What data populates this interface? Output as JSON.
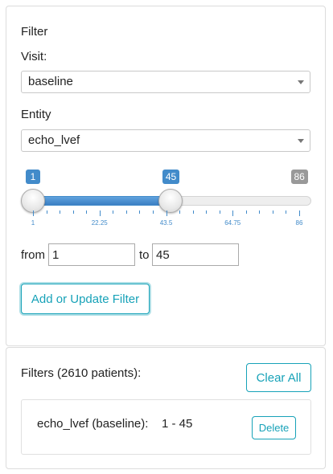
{
  "filter_panel": {
    "title": "Filter",
    "visit_label": "Visit:",
    "visit_value": "baseline",
    "entity_label": "Entity",
    "entity_value": "echo_lvef",
    "slider": {
      "min": 1,
      "max": 86,
      "from": 1,
      "to": 45,
      "min_label": "1",
      "max_label": "86",
      "from_label": "1",
      "to_label": "45",
      "tick_labels": [
        "1",
        "22.25",
        "43.5",
        "64.75",
        "86"
      ],
      "accent_color": "#428bca"
    },
    "from_label": "from",
    "to_label": "to",
    "from_value": "1",
    "to_value": "45",
    "add_button": "Add or Update Filter"
  },
  "filters_panel": {
    "title": "Filters (2610 patients):",
    "clear_button": "Clear All",
    "items": [
      {
        "name": "echo_lvef (baseline):",
        "range": "1 - 45",
        "delete_label": "Delete"
      }
    ]
  },
  "colors": {
    "button_text": "#17a2b8",
    "badge_blue": "#428bca",
    "badge_grey": "#999999"
  }
}
